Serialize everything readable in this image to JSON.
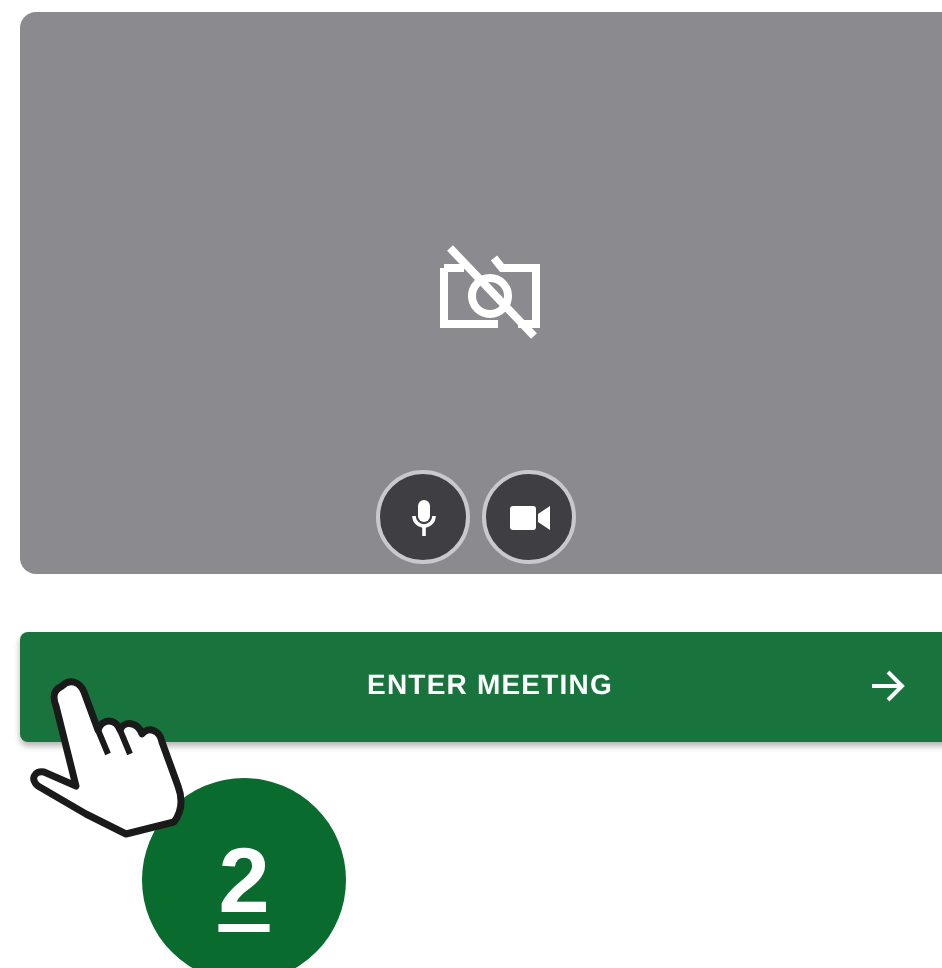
{
  "preview": {
    "camera_on": false,
    "controls": [
      {
        "kind": "mic"
      },
      {
        "kind": "camera"
      }
    ]
  },
  "enter_button": {
    "label": "ENTER MEETING"
  },
  "step_badge": {
    "label": "2"
  }
}
